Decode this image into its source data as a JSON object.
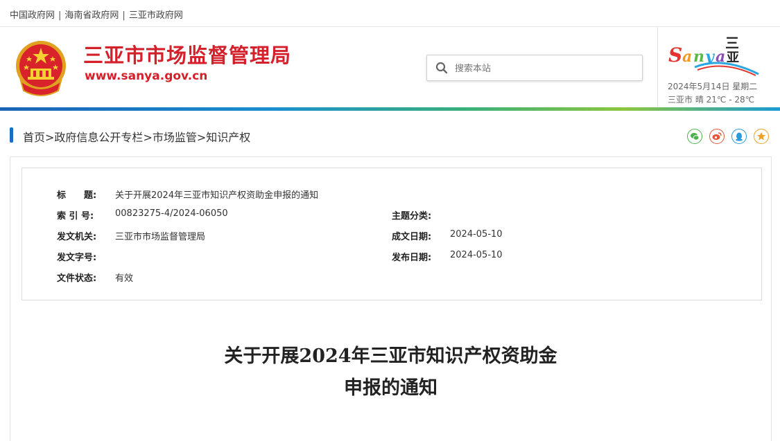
{
  "top_links": [
    "中国政府网",
    "海南省政府网",
    "三亚市政府网"
  ],
  "top_sep": "|",
  "header": {
    "title": "三亚市市场监督管理局",
    "url": "www.sanya.gov.cn",
    "search_placeholder": "搜索本站",
    "logo_text": "Sanya",
    "logo_cn": "三亚",
    "date": "2024年5月14日 星期二",
    "weather": "三亚市  晴  21℃ - 28℃"
  },
  "breadcrumb": [
    "首页",
    "政府信息公开专栏",
    "市场监管",
    "知识产权"
  ],
  "breadcrumb_sep": ">",
  "share_icons": [
    {
      "name": "wechat-share-icon",
      "color": "#4bb34b"
    },
    {
      "name": "weibo-share-icon",
      "color": "#e6553a"
    },
    {
      "name": "qq-share-icon",
      "color": "#2a9bd8"
    },
    {
      "name": "favorite-star-icon",
      "color": "#f0a020"
    }
  ],
  "info": {
    "title_label": "标　　题:",
    "title_value": "关于开展2024年三亚市知识产权资助金申报的通知",
    "index_label": "索 引 号:",
    "index_value": "00823275-4/2024-06050",
    "topic_label": "主题分类:",
    "topic_value": "",
    "org_label": "发文机关:",
    "org_value": "三亚市市场监督管理局",
    "created_label": "成文日期:",
    "created_value": "2024-05-10",
    "docno_label": "发文字号:",
    "docno_value": "",
    "published_label": "发布日期:",
    "published_value": "2024-05-10",
    "status_label": "文件状态:",
    "status_value": "有效"
  },
  "article": {
    "title_line1": "关于开展2024年三亚市知识产权资助金",
    "title_line2": "申报的通知"
  },
  "colors": {
    "brand_red": "#d4202a",
    "accent_blue": "#1b6cc3"
  }
}
